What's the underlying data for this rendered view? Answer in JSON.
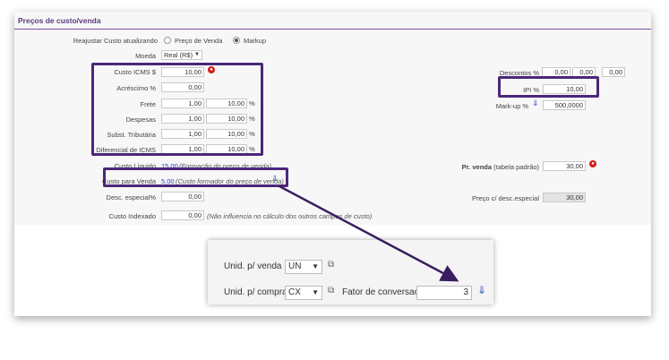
{
  "section_title": "Preços de custo/venda",
  "reajustar": {
    "label": "Reajustar Custo atualizando",
    "option1": "Preço de Venda",
    "option2": "Markup",
    "selected": "Markup"
  },
  "moeda": {
    "label": "Moeda",
    "value": "Real (R$)"
  },
  "rows": {
    "custo_icms": {
      "label": "Custo ICMS $",
      "value": "10,00"
    },
    "acrescimo": {
      "label": "Acréscimo %",
      "value": "0,00"
    },
    "frete": {
      "label": "Frete",
      "v1": "1,00",
      "v2": "10,00",
      "unit": "%"
    },
    "despesas": {
      "label": "Despesas",
      "v1": "1,00",
      "v2": "10,00",
      "unit": "%"
    },
    "subst": {
      "label": "Subst. Tributária",
      "v1": "1,00",
      "v2": "10,00",
      "unit": "%"
    },
    "dif_icms": {
      "label": "Diferencial de ICMS",
      "v1": "1,00",
      "v2": "10,00",
      "unit": "%"
    }
  },
  "custo_liquido": {
    "label": "Custo Líquido",
    "value": "15,00",
    "note": "(Formação do preço de venda)"
  },
  "custo_para_venda": {
    "label": "Custo para Venda",
    "value": "5,00",
    "note": "(Custo formador do preço de venda)"
  },
  "desc_especial": {
    "label": "Desc. especial%",
    "value": "0,00"
  },
  "custo_indexado": {
    "label": "Custo Indexado",
    "value": "0,00",
    "note": "(Não influencia no cálculo dos outros campos de custo)"
  },
  "right": {
    "descontos": {
      "label": "Descontos %",
      "v1": "0,00",
      "v2": "0,00",
      "v3": "0,00"
    },
    "ipi": {
      "label": "IPI %",
      "value": "10,00"
    },
    "markup": {
      "label": "Mark-up %",
      "value": "500,0000"
    },
    "pr_venda": {
      "label_bold": "Pr. venda",
      "label_rest": "(tabela padrão)",
      "value": "30,00"
    },
    "preco_desc": {
      "label": "Preço c/ desc.especial",
      "value": "30,00"
    }
  },
  "zoom": {
    "unid_venda": {
      "label": "Unid. p/ venda",
      "value": "UN"
    },
    "unid_compra": {
      "label": "Unid. p/ compra",
      "value": "CX"
    },
    "fator": {
      "label": "Fator de conversao:",
      "value": "3"
    }
  },
  "colors": {
    "highlight": "#4b2779",
    "header_text": "#5b3a7e",
    "blue_value": "#2943b8",
    "alert_red": "#d41c1c"
  },
  "icons": [
    "external-link-icon",
    "download-arrow-icon",
    "red-alert-icon"
  ]
}
